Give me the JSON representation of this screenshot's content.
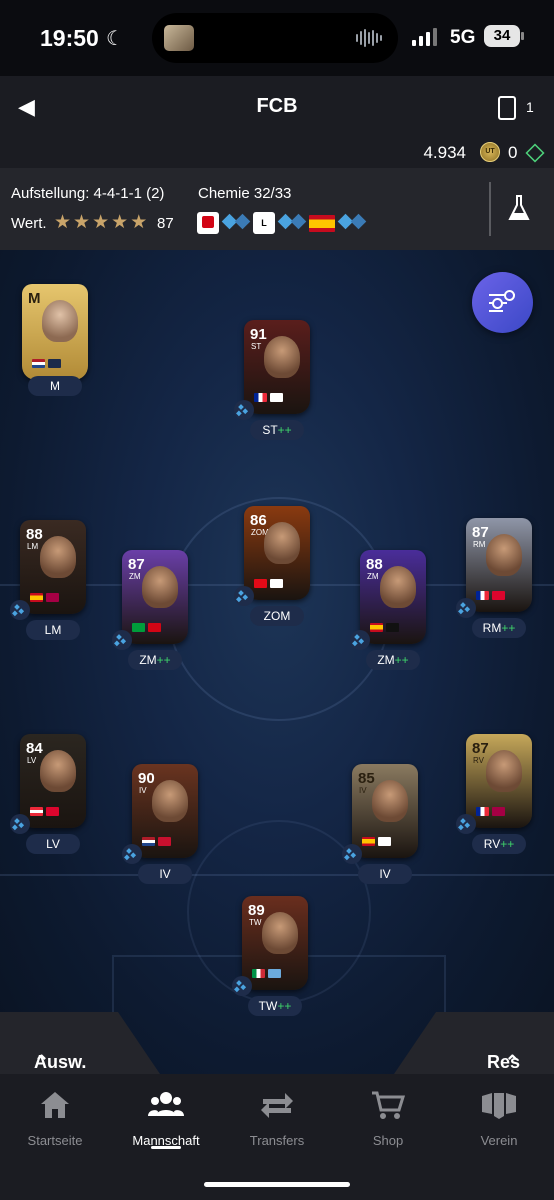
{
  "status": {
    "time": "19:50",
    "network": "5G",
    "battery": "34"
  },
  "header": {
    "title": "FCB",
    "card_count": "1",
    "coins": "4.934",
    "points": "0"
  },
  "info": {
    "formation_label": "Aufstellung: 4-4-1-1 (2)",
    "chemistry_label": "Chemie 32/33",
    "value_label": "Wert.",
    "stars": 5,
    "rating": "87"
  },
  "manager": {
    "pos": "M",
    "label": "M"
  },
  "players": [
    {
      "ovr": "91",
      "pos": "ST",
      "label": "ST",
      "plus": "++",
      "color": "#5a1e1c"
    },
    {
      "ovr": "88",
      "pos": "LM",
      "label": "LM",
      "plus": "",
      "color": "#3a2a22"
    },
    {
      "ovr": "86",
      "pos": "ZOM",
      "label": "ZOM",
      "plus": "",
      "color": "#8a3a10"
    },
    {
      "ovr": "87",
      "pos": "RM",
      "label": "RM",
      "plus": "++",
      "color": "#8f96a8"
    },
    {
      "ovr": "87",
      "pos": "ZM",
      "label": "ZM",
      "plus": "++",
      "color": "#6a3fa8"
    },
    {
      "ovr": "88",
      "pos": "ZM",
      "label": "ZM",
      "plus": "++",
      "color": "#4a2d9a"
    },
    {
      "ovr": "84",
      "pos": "LV",
      "label": "LV",
      "plus": "",
      "color": "#2b2620"
    },
    {
      "ovr": "87",
      "pos": "RV",
      "label": "RV",
      "plus": "++",
      "color": "#c6a85a"
    },
    {
      "ovr": "90",
      "pos": "IV",
      "label": "IV",
      "plus": "",
      "color": "#6a3420"
    },
    {
      "ovr": "85",
      "pos": "IV",
      "label": "IV",
      "plus": "",
      "color": "#8a7a60"
    },
    {
      "ovr": "89",
      "pos": "TW",
      "label": "TW",
      "plus": "++",
      "color": "#6a2e1e"
    }
  ],
  "bottom": {
    "left_label": "Ausw.",
    "right_label": "Res"
  },
  "tabs": [
    {
      "label": "Startseite",
      "icon": "home-icon"
    },
    {
      "label": "Mannschaft",
      "icon": "team-icon"
    },
    {
      "label": "Transfers",
      "icon": "transfers-icon"
    },
    {
      "label": "Shop",
      "icon": "shop-icon"
    },
    {
      "label": "Verein",
      "icon": "club-icon"
    }
  ]
}
